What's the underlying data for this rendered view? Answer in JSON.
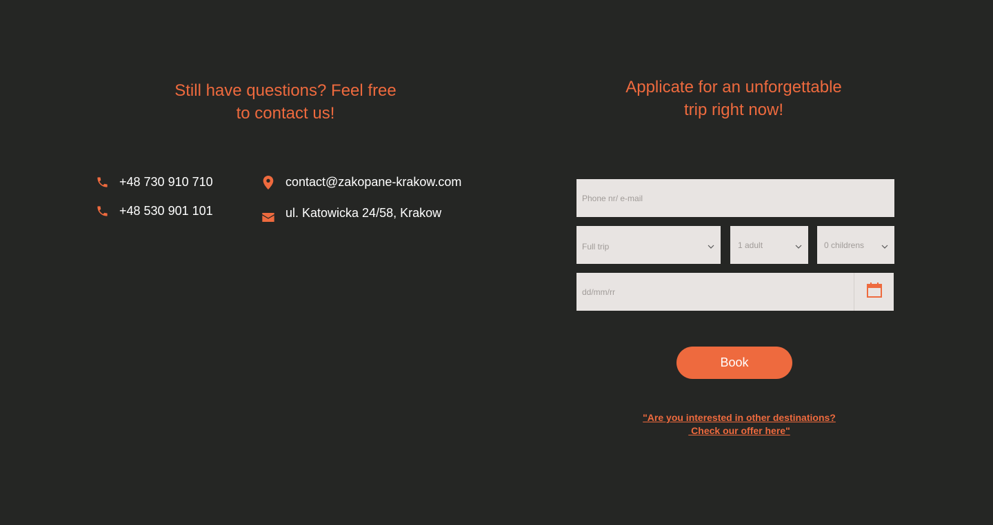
{
  "contact_section": {
    "heading_line1": "Still have questions? Feel free",
    "heading_line2": "to contact us!",
    "phone_1": "+48 730 910 710",
    "phone_2": "+48 530 901 101",
    "email": "contact@zakopane-krakow.com",
    "address": "ul. Katowicka 24/58, Krakow",
    "icons": [
      "phone-icon",
      "phone-icon",
      "location-pin-icon",
      "mail-icon"
    ]
  },
  "booking_form": {
    "heading_line1": "Applicate for an unforgettable",
    "heading_line2": "trip right now!",
    "contact_placeholder": "Phone nr/ e-mail",
    "trip_value": "Full trip",
    "adults_value": "1 adult",
    "children_value": "0 childrens",
    "date_placeholder": "dd/mm/rr",
    "book_label": "Book",
    "offer_link_line1": "\"Are you interested in other destinations?",
    "offer_link_line2": " Check our offer here\""
  },
  "colors": {
    "background": "#252624",
    "accent": "#ee6a3e",
    "field_bg": "#e8e4e2",
    "text": "#ffffff"
  }
}
